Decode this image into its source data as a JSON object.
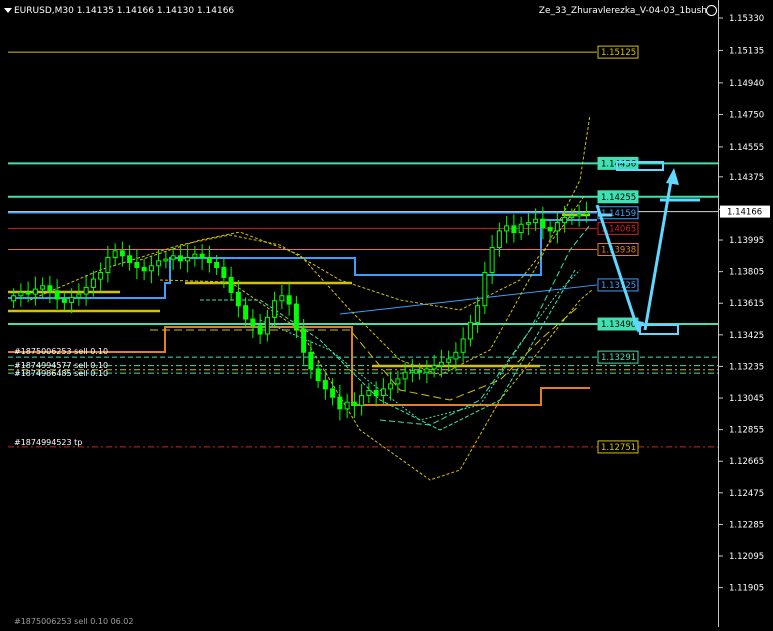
{
  "header": {
    "symbol_info": "EURUSD,M30  1.14135 1.14166 1.14130 1.14166",
    "expert_name": "Ze_33_Zhuravlerezka_V-04-03_1bush"
  },
  "colors": {
    "background": "#000000",
    "bull_candle": "#00ff00",
    "grid_text": "#ffffff",
    "level_yellow": "#d4c200",
    "level_green": "#40e0b0",
    "level_blue": "#3aa0ff",
    "level_red": "#d02020",
    "level_orange": "#e08020",
    "arrow_cyan": "#60d8ff",
    "bid_line": "#d8d8d8"
  },
  "price_axis": {
    "ticks": [
      "1.15330",
      "1.15135",
      "1.14940",
      "1.14750",
      "1.14555",
      "1.14375",
      "1.14180",
      "1.13995",
      "1.13805",
      "1.13615",
      "1.13425",
      "1.13235",
      "1.13045",
      "1.12855",
      "1.12665",
      "1.12475",
      "1.12285",
      "1.12095",
      "1.11905"
    ],
    "current_price": "1.14166"
  },
  "level_labels": [
    {
      "name": "level-15125",
      "text": "1.15125",
      "color": "#d4c200",
      "bg": "#000000",
      "fg": "#d4c200"
    },
    {
      "name": "level-14456",
      "text": "1.14456",
      "color": "#40e0b0",
      "bg": "#40e0b0",
      "fg": "#000000"
    },
    {
      "name": "level-14255",
      "text": "1.14255",
      "color": "#40e0b0",
      "bg": "#40e0b0",
      "fg": "#000000"
    },
    {
      "name": "level-14159",
      "text": "1.14159",
      "color": "#3aa0ff",
      "bg": "#000000",
      "fg": "#3aa0ff"
    },
    {
      "name": "level-14065",
      "text": "1.14065",
      "color": "#d02020",
      "bg": "#000000",
      "fg": "#d02020"
    },
    {
      "name": "level-13938",
      "text": "1.13938",
      "color": "#e08020",
      "bg": "#000000",
      "fg": "#e08020"
    },
    {
      "name": "level-13725",
      "text": "1.13725",
      "color": "#3aa0ff",
      "bg": "#000000",
      "fg": "#3aa0ff"
    },
    {
      "name": "level-13490",
      "text": "1.13490",
      "color": "#40e0b0",
      "bg": "#40e0b0",
      "fg": "#000000"
    },
    {
      "name": "level-13291",
      "text": "1.13291",
      "color": "#40e0b0",
      "bg": "#000000",
      "fg": "#40e0b0"
    },
    {
      "name": "level-12751",
      "text": "1.12751",
      "color": "#d4c200",
      "bg": "#000000",
      "fg": "#d4c200"
    }
  ],
  "order_labels": [
    {
      "name": "order-label-1",
      "text": "#1875006253 sell 0.10"
    },
    {
      "name": "order-label-2",
      "text": "#1874994577 sell 0.10"
    },
    {
      "name": "order-label-3",
      "text": "#1874986485 sell 0.10"
    },
    {
      "name": "order-label-tp",
      "text": "#1874994523 tp"
    }
  ],
  "footer_text": "#1875006253 sell 0.10 06.02"
}
